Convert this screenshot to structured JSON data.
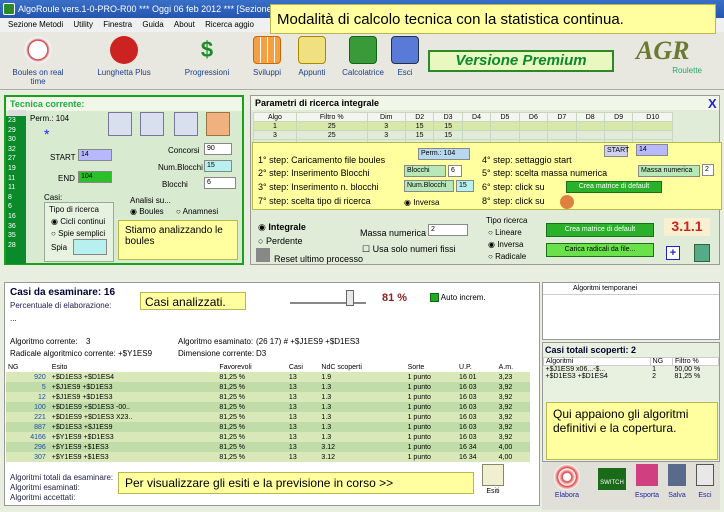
{
  "window": {
    "title": "AlgoRoule vers.1-0-PRO-R00   ***   Oggi 06 feb 2012   ***   [Sezione"
  },
  "menu": [
    "Sezione Metodi",
    "Utility",
    "Finestra",
    "Guida",
    "About",
    "Ricerca aggio"
  ],
  "toolbar": [
    {
      "label": "Boules on real time",
      "icon": "clock-icon"
    },
    {
      "label": "Lunghetta Plus",
      "icon": "gift-icon"
    },
    {
      "label": "Progressioni",
      "icon": "dollar-icon"
    },
    {
      "label": "Sviluppi",
      "icon": "calendar-icon"
    },
    {
      "label": "Appunti",
      "icon": "notes-icon"
    },
    {
      "label": "Calcolatrice",
      "icon": "calculator-icon"
    },
    {
      "label": "Esci",
      "icon": "exit-icon"
    }
  ],
  "premium": "Versione Premium",
  "headline": "Modalità di calcolo tecnica con la statistica continua.",
  "logo": {
    "letters": "AGR",
    "sub": "Roulette"
  },
  "left": {
    "header": "Tecnica corrente:",
    "perm": "Perm.: 104",
    "numbers": [
      "23",
      "29",
      "30",
      "32",
      "27",
      "19",
      "11",
      "11",
      "8",
      "6",
      "16",
      "36",
      "35",
      "28"
    ],
    "start_label": "START",
    "start_val": "14",
    "end_label": "END",
    "end_val": "104",
    "concorsi_label": "Concorsi",
    "concorsi_val": "90",
    "numblocchi_label": "Num.Blocchi",
    "numblocchi_val": "15",
    "blocchi_label": "Blocchi",
    "blocchi_val": "6",
    "casi_label": "Casi:",
    "tipo_label": "Tipo di ricerca",
    "cicli": "Cicli continui",
    "spie": "Spie semplici",
    "spia": "Spia",
    "analisi": "Analisi su...",
    "boules": "Boules",
    "anamnesi": "Anamnesi",
    "note": "Stiamo analizzando le boules"
  },
  "params": {
    "header": "Parametri di ricerca integrale",
    "columns": [
      "Algo",
      "Filtro %",
      "Dim",
      "D2",
      "D3",
      "D4",
      "D5",
      "D6",
      "D7",
      "D8",
      "D9",
      "D10"
    ],
    "rows": [
      [
        "1",
        "25",
        "3",
        "15",
        "15",
        "",
        "",
        "",
        "",
        "",
        "",
        ""
      ],
      [
        "3",
        "25",
        "3",
        "15",
        "15",
        "",
        "",
        "",
        "",
        "",
        "",
        ""
      ]
    ],
    "steps": [
      "1° step: Caricamento file boules",
      "2° step: Inserimento Blocchi",
      "3° step: Inserimento n. blocchi",
      "7° step: scelta tipo di ricerca",
      "4° step: settaggio start",
      "5° step: scelta massa numerica",
      "6° step: click su",
      "8° step: click su"
    ],
    "perm_btn": "Perm.: 104",
    "start_btn": "START",
    "start_val": "14",
    "blocchi_btn": "Blocchi",
    "blocchi_val": "6",
    "numblocchi_btn": "Num.Blocchi",
    "numblocchi_val": "15",
    "massa_btn": "Massa numerica",
    "massa_val": "2",
    "inversa": "Inversa",
    "crea_btn": "Crea matrice di default",
    "carica_btn": "Carica radicali da file...",
    "integrale": "Integrale",
    "perdente": "Perdente",
    "massa_label": "Massa numerica",
    "massa_sel": "2",
    "usa": "Usa solo numeri fissi",
    "reset": "Reset ultimo processo",
    "tipo": "Tipo ricerca",
    "lineare": "Lineare",
    "inversa2": "Inversa",
    "radicale": "Radicale",
    "version": "3.1.1",
    "plus": "+"
  },
  "casi": {
    "header": "Casi da esaminare: 16",
    "perc_label": "Percentuale di elaborazione:",
    "callout": "Casi analizzati.",
    "percent": "81 %",
    "auto": "Auto increm.",
    "alg_corr_label": "Algoritmo corrente:",
    "alg_corr_val": "3",
    "alg_esam_label": "Algoritmo esaminato:",
    "alg_esam_val": "(26 17) # +$J1ES9 +$D1ES3",
    "rad_label": "Radicale algoritmico corrente:",
    "rad_val": "+$Y1ES9",
    "dim_label": "Dimensione corrente:",
    "dim_val": "D3",
    "columns": [
      "NG",
      "Esito",
      "Favorevoli",
      "Casi",
      "NdC scoperti",
      "Sorte",
      "U.P.",
      "A.m."
    ],
    "rows": [
      [
        "920",
        "+$D1ES3 +$D1ES4",
        "81,25 %",
        "13",
        "1.9",
        "1 punto",
        "16 01",
        "3,23"
      ],
      [
        "5",
        "+$J1ES9 +$D1ES3",
        "81,25 %",
        "13",
        "1.3",
        "1 punto",
        "16 03",
        "3,92"
      ],
      [
        "12",
        "+$J1ES9 +$D1ES3",
        "81,25 %",
        "13",
        "1.3",
        "1 punto",
        "16 03",
        "3,92"
      ],
      [
        "100",
        "+$D1ES9 +$D1ES3 -00..",
        "81,25 %",
        "13",
        "1.3",
        "1 punto",
        "16 03",
        "3,92"
      ],
      [
        "221",
        "+$D1ES9 +$D1ES3 X23..",
        "81,25 %",
        "13",
        "1.3",
        "1 punto",
        "16 03",
        "3,92"
      ],
      [
        "887",
        "+$D1ES3 +$J1ES9",
        "81,25 %",
        "13",
        "1.3",
        "1 punto",
        "16 03",
        "3,92"
      ],
      [
        "4166",
        "+$Y1ES9 +$D1ES3",
        "81,25 %",
        "13",
        "1.3",
        "1 punto",
        "16 03",
        "3,92"
      ],
      [
        "296",
        "+$Y1ES9 +$1ES3",
        "81,25 %",
        "13",
        "3.12",
        "1 punto",
        "16 34",
        "4,00"
      ],
      [
        "307",
        "+$Y1ES9 +$1ES3",
        "81,25 %",
        "13",
        "3.12",
        "1 punto",
        "16 34",
        "4,00"
      ]
    ],
    "tot_label": "Algoritmi totali da esaminare:",
    "esam_label": "Algoritmi esaminati:",
    "acc_label": "Algoritmi accettati:",
    "bottom_callout": "Per visualizzare gli esiti e la previsione in corso >>",
    "esiti": "Esiti"
  },
  "right": {
    "temp_header": "Algoritmi temporanei",
    "tot_header": "Casi totali scoperti:",
    "tot_val": "2",
    "columns": [
      "Algoritmi",
      "NG",
      "Filtro %"
    ],
    "rows": [
      [
        "+$J1ES9 x06...-$...",
        "1",
        "50,00 %"
      ],
      [
        "+$D1ES3 +$D1ES4",
        "2",
        "81,25 %"
      ]
    ],
    "callout": "Qui appaiono gli algoritmi definitivi e la copertura.",
    "tools": [
      "Elabora",
      "Esporta",
      "Salva",
      "Esci"
    ],
    "switch": "SWITCH"
  },
  "colors": {
    "accent": "#1aa01a",
    "callout": "#ffffa0",
    "titlebar": "#2456b0"
  }
}
